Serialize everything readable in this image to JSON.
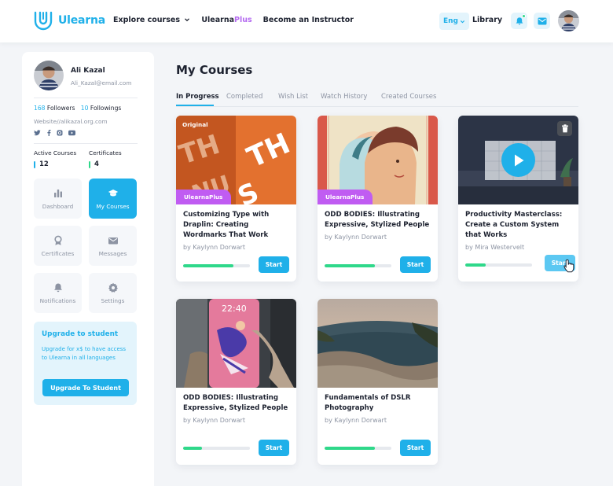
{
  "header": {
    "brand": "Ulearna",
    "nav": {
      "explore": "Explore courses",
      "plus_prefix": "Ulearna",
      "plus_suffix": "Plus",
      "instructor": "Become an Instructor"
    },
    "language": "Eng",
    "library": "Library"
  },
  "profile": {
    "name": "Ali Kazal",
    "email": "Ali_Kazal@email.com",
    "followers_count": "168",
    "followers_label": "Followers",
    "followings_count": "10",
    "followings_label": "Followings",
    "website": "Website//alikazal.org.com",
    "socials": [
      "twitter-icon",
      "facebook-icon",
      "instagram-icon",
      "youtube-icon"
    ]
  },
  "stats": {
    "active_label": "Active Courses",
    "active_value": "12",
    "cert_label": "Certificates",
    "cert_value": "4"
  },
  "menu": {
    "dashboard": "Dashboard",
    "my_courses": "My Courses",
    "certificates": "Certificates",
    "messages": "Messages",
    "notifications": "Notifications",
    "settings": "Settings"
  },
  "upgrade": {
    "title": "Upgrade to student",
    "text": "Upgrade for x$ to have access to Ulearna in all languages",
    "button": "Upgrade To Student"
  },
  "main": {
    "title": "My Courses",
    "tabs": [
      "In Progress",
      "Completed",
      "Wish List",
      "Watch History",
      "Created Courses"
    ],
    "active_tab": "In Progress"
  },
  "courses": [
    {
      "title": "Customizing Type with Draplin: Creating Wordmarks That Work",
      "author": "by Kaylynn Dorwart",
      "badge": "UlearnaPlus",
      "corner_label": "Original",
      "progress": 0.75,
      "button": "Start"
    },
    {
      "title": "ODD BODIES: Illustrating Expressive, Stylized People",
      "author": "by Kaylynn Dorwart",
      "badge": "UlearnaPlus",
      "progress": 0.75,
      "button": "Start"
    },
    {
      "title": "Productivity Masterclass: Create a Custom System that Works",
      "author": "by Mira Westervelt",
      "progress": 0.3,
      "button": "Start"
    },
    {
      "title": "ODD BODIES: Illustrating Expressive, Stylized People",
      "author": "by Kaylynn Dorwart",
      "progress": 0.28,
      "button": "Start"
    },
    {
      "title": "Fundamentals of DSLR Photography",
      "author": "by Kaylynn Dorwart",
      "progress": 0.75,
      "button": "Start"
    }
  ],
  "colors": {
    "accent": "#1fb0e9",
    "plus": "#c05cf2",
    "progress": "#2fd88a",
    "active_bar": "#1fb0e9",
    "cert_bar": "#2fd88a"
  }
}
